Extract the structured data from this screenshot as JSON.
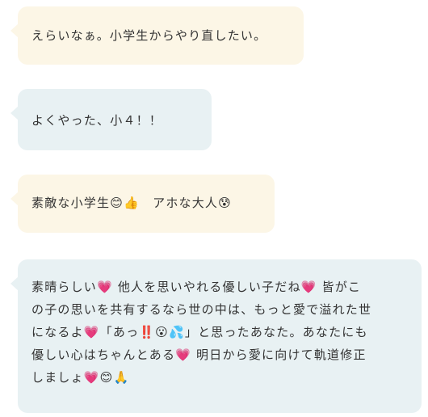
{
  "messages": [
    {
      "text": "えらいなぁ。小学生からやり直したい。"
    },
    {
      "text": "よくやった、小４！！"
    },
    {
      "text": "素敵な小学生😊👍　アホな大人😰"
    },
    {
      "lines": [
        "素晴らしい💗 他人を思いやれる優しい子だね💗 皆がこ",
        "の子の思いを共有するなら世の中は、もっと愛で溢れた世",
        "になるよ💗「あっ‼️😮💦」と思ったあなた。あなたにも",
        "優しい心はちゃんとある💗 明日から愛に向けて軌道修正",
        "しましょ💗😊🙏"
      ]
    }
  ],
  "colors": {
    "cream_bubble": "#fcf6e6",
    "blue_bubble": "#e8f1f3",
    "text": "#333333"
  }
}
